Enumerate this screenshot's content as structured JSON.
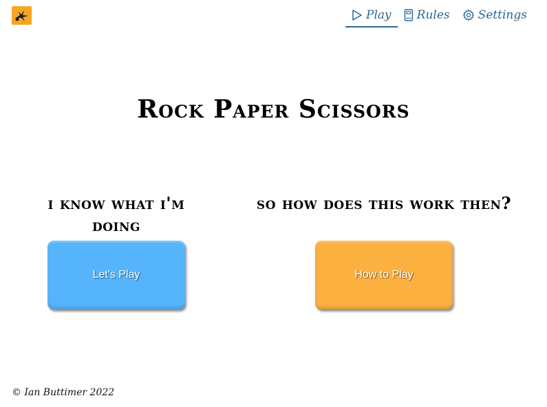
{
  "header": {
    "logo_icon": "rock-paper-scissors-logo",
    "nav": [
      {
        "label": "Play",
        "icon": "play-icon"
      },
      {
        "label": "Rules",
        "icon": "book-icon"
      },
      {
        "label": "Settings",
        "icon": "gear-icon"
      }
    ]
  },
  "main": {
    "title": "Rock Paper Scissors",
    "left": {
      "heading": "I know what I'm doing",
      "button_label": "Let's Play"
    },
    "right": {
      "heading": "So how does this work then?",
      "button_label": "How to Play"
    }
  },
  "footer": {
    "copyright": "© Ian Buttimer 2022"
  },
  "colors": {
    "accent": "#2d6591",
    "play_button": "#56b4fc",
    "how_button": "#fbb040",
    "logo_bg": "#f5a623"
  }
}
